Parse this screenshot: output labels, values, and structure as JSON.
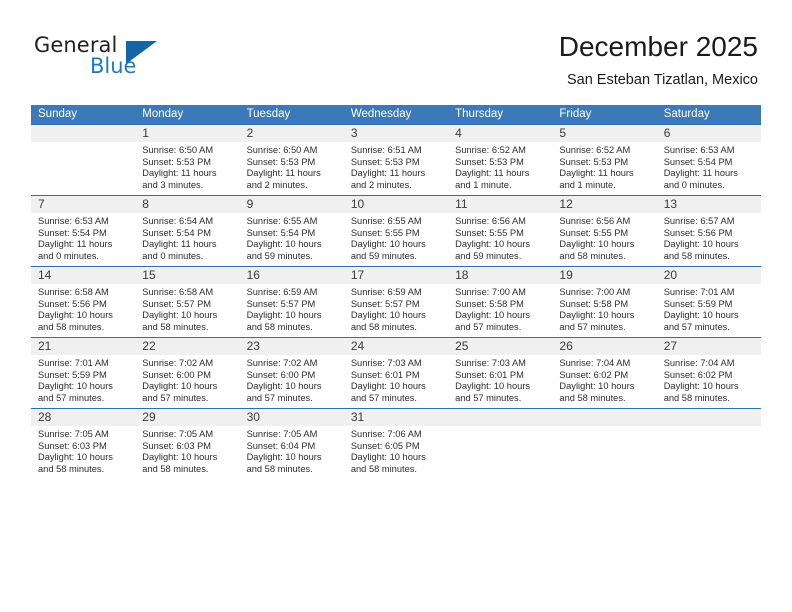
{
  "brand": {
    "name_part1": "General",
    "name_part2": "Blue",
    "accent_color": "#1f7ac4",
    "triangle_color": "#1266a8"
  },
  "header": {
    "title": "December 2025",
    "subtitle": "San Esteban Tizatlan, Mexico",
    "header_bg": "#3b79b8",
    "row_divider": "#2c6fb0",
    "daynum_bg": "#f0f0f0"
  },
  "weekdays": [
    "Sunday",
    "Monday",
    "Tuesday",
    "Wednesday",
    "Thursday",
    "Friday",
    "Saturday"
  ],
  "weeks": [
    [
      {
        "day": "",
        "lines": []
      },
      {
        "day": "1",
        "lines": [
          "Sunrise: 6:50 AM",
          "Sunset: 5:53 PM",
          "Daylight: 11 hours",
          "and 3 minutes."
        ]
      },
      {
        "day": "2",
        "lines": [
          "Sunrise: 6:50 AM",
          "Sunset: 5:53 PM",
          "Daylight: 11 hours",
          "and 2 minutes."
        ]
      },
      {
        "day": "3",
        "lines": [
          "Sunrise: 6:51 AM",
          "Sunset: 5:53 PM",
          "Daylight: 11 hours",
          "and 2 minutes."
        ]
      },
      {
        "day": "4",
        "lines": [
          "Sunrise: 6:52 AM",
          "Sunset: 5:53 PM",
          "Daylight: 11 hours",
          "and 1 minute."
        ]
      },
      {
        "day": "5",
        "lines": [
          "Sunrise: 6:52 AM",
          "Sunset: 5:53 PM",
          "Daylight: 11 hours",
          "and 1 minute."
        ]
      },
      {
        "day": "6",
        "lines": [
          "Sunrise: 6:53 AM",
          "Sunset: 5:54 PM",
          "Daylight: 11 hours",
          "and 0 minutes."
        ]
      }
    ],
    [
      {
        "day": "7",
        "lines": [
          "Sunrise: 6:53 AM",
          "Sunset: 5:54 PM",
          "Daylight: 11 hours",
          "and 0 minutes."
        ]
      },
      {
        "day": "8",
        "lines": [
          "Sunrise: 6:54 AM",
          "Sunset: 5:54 PM",
          "Daylight: 11 hours",
          "and 0 minutes."
        ]
      },
      {
        "day": "9",
        "lines": [
          "Sunrise: 6:55 AM",
          "Sunset: 5:54 PM",
          "Daylight: 10 hours",
          "and 59 minutes."
        ]
      },
      {
        "day": "10",
        "lines": [
          "Sunrise: 6:55 AM",
          "Sunset: 5:55 PM",
          "Daylight: 10 hours",
          "and 59 minutes."
        ]
      },
      {
        "day": "11",
        "lines": [
          "Sunrise: 6:56 AM",
          "Sunset: 5:55 PM",
          "Daylight: 10 hours",
          "and 59 minutes."
        ]
      },
      {
        "day": "12",
        "lines": [
          "Sunrise: 6:56 AM",
          "Sunset: 5:55 PM",
          "Daylight: 10 hours",
          "and 58 minutes."
        ]
      },
      {
        "day": "13",
        "lines": [
          "Sunrise: 6:57 AM",
          "Sunset: 5:56 PM",
          "Daylight: 10 hours",
          "and 58 minutes."
        ]
      }
    ],
    [
      {
        "day": "14",
        "lines": [
          "Sunrise: 6:58 AM",
          "Sunset: 5:56 PM",
          "Daylight: 10 hours",
          "and 58 minutes."
        ]
      },
      {
        "day": "15",
        "lines": [
          "Sunrise: 6:58 AM",
          "Sunset: 5:57 PM",
          "Daylight: 10 hours",
          "and 58 minutes."
        ]
      },
      {
        "day": "16",
        "lines": [
          "Sunrise: 6:59 AM",
          "Sunset: 5:57 PM",
          "Daylight: 10 hours",
          "and 58 minutes."
        ]
      },
      {
        "day": "17",
        "lines": [
          "Sunrise: 6:59 AM",
          "Sunset: 5:57 PM",
          "Daylight: 10 hours",
          "and 58 minutes."
        ]
      },
      {
        "day": "18",
        "lines": [
          "Sunrise: 7:00 AM",
          "Sunset: 5:58 PM",
          "Daylight: 10 hours",
          "and 57 minutes."
        ]
      },
      {
        "day": "19",
        "lines": [
          "Sunrise: 7:00 AM",
          "Sunset: 5:58 PM",
          "Daylight: 10 hours",
          "and 57 minutes."
        ]
      },
      {
        "day": "20",
        "lines": [
          "Sunrise: 7:01 AM",
          "Sunset: 5:59 PM",
          "Daylight: 10 hours",
          "and 57 minutes."
        ]
      }
    ],
    [
      {
        "day": "21",
        "lines": [
          "Sunrise: 7:01 AM",
          "Sunset: 5:59 PM",
          "Daylight: 10 hours",
          "and 57 minutes."
        ]
      },
      {
        "day": "22",
        "lines": [
          "Sunrise: 7:02 AM",
          "Sunset: 6:00 PM",
          "Daylight: 10 hours",
          "and 57 minutes."
        ]
      },
      {
        "day": "23",
        "lines": [
          "Sunrise: 7:02 AM",
          "Sunset: 6:00 PM",
          "Daylight: 10 hours",
          "and 57 minutes."
        ]
      },
      {
        "day": "24",
        "lines": [
          "Sunrise: 7:03 AM",
          "Sunset: 6:01 PM",
          "Daylight: 10 hours",
          "and 57 minutes."
        ]
      },
      {
        "day": "25",
        "lines": [
          "Sunrise: 7:03 AM",
          "Sunset: 6:01 PM",
          "Daylight: 10 hours",
          "and 57 minutes."
        ]
      },
      {
        "day": "26",
        "lines": [
          "Sunrise: 7:04 AM",
          "Sunset: 6:02 PM",
          "Daylight: 10 hours",
          "and 58 minutes."
        ]
      },
      {
        "day": "27",
        "lines": [
          "Sunrise: 7:04 AM",
          "Sunset: 6:02 PM",
          "Daylight: 10 hours",
          "and 58 minutes."
        ]
      }
    ],
    [
      {
        "day": "28",
        "lines": [
          "Sunrise: 7:05 AM",
          "Sunset: 6:03 PM",
          "Daylight: 10 hours",
          "and 58 minutes."
        ]
      },
      {
        "day": "29",
        "lines": [
          "Sunrise: 7:05 AM",
          "Sunset: 6:03 PM",
          "Daylight: 10 hours",
          "and 58 minutes."
        ]
      },
      {
        "day": "30",
        "lines": [
          "Sunrise: 7:05 AM",
          "Sunset: 6:04 PM",
          "Daylight: 10 hours",
          "and 58 minutes."
        ]
      },
      {
        "day": "31",
        "lines": [
          "Sunrise: 7:06 AM",
          "Sunset: 6:05 PM",
          "Daylight: 10 hours",
          "and 58 minutes."
        ]
      },
      {
        "day": "",
        "lines": []
      },
      {
        "day": "",
        "lines": []
      },
      {
        "day": "",
        "lines": []
      }
    ]
  ]
}
